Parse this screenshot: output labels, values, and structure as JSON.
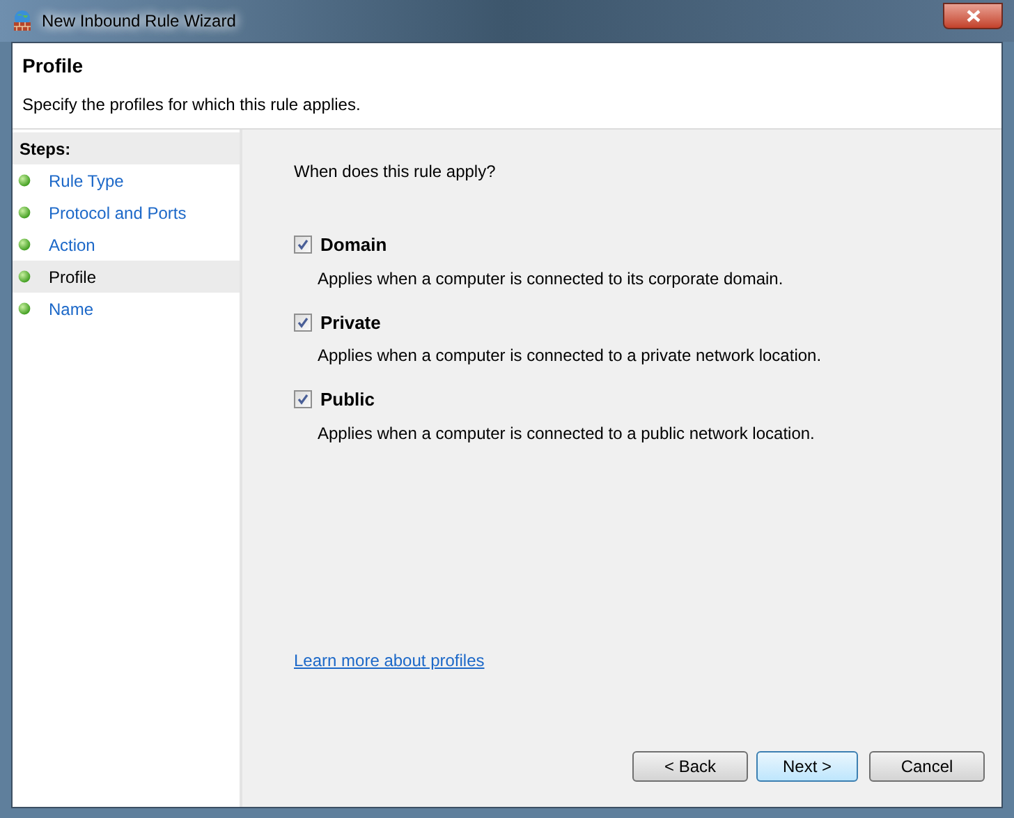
{
  "window": {
    "title": "New Inbound Rule Wizard"
  },
  "header": {
    "title": "Profile",
    "description": "Specify the profiles for which this rule applies."
  },
  "steps": {
    "heading": "Steps:",
    "items": [
      {
        "label": "Rule Type",
        "selected": false
      },
      {
        "label": "Protocol and Ports",
        "selected": false
      },
      {
        "label": "Action",
        "selected": false
      },
      {
        "label": "Profile",
        "selected": true
      },
      {
        "label": "Name",
        "selected": false
      }
    ]
  },
  "question": "When does this rule apply?",
  "profiles": [
    {
      "label": "Domain",
      "checked": true,
      "description": "Applies when a computer is connected to its corporate domain."
    },
    {
      "label": "Private",
      "checked": true,
      "description": "Applies when a computer is connected to a private network location."
    },
    {
      "label": "Public",
      "checked": true,
      "description": "Applies when a computer is connected to a public network location."
    }
  ],
  "link": "Learn more about profiles",
  "buttons": [
    {
      "label": "< Back",
      "kind": "normal"
    },
    {
      "label": "Next >",
      "kind": "default"
    },
    {
      "label": "Cancel",
      "kind": "normal"
    }
  ]
}
